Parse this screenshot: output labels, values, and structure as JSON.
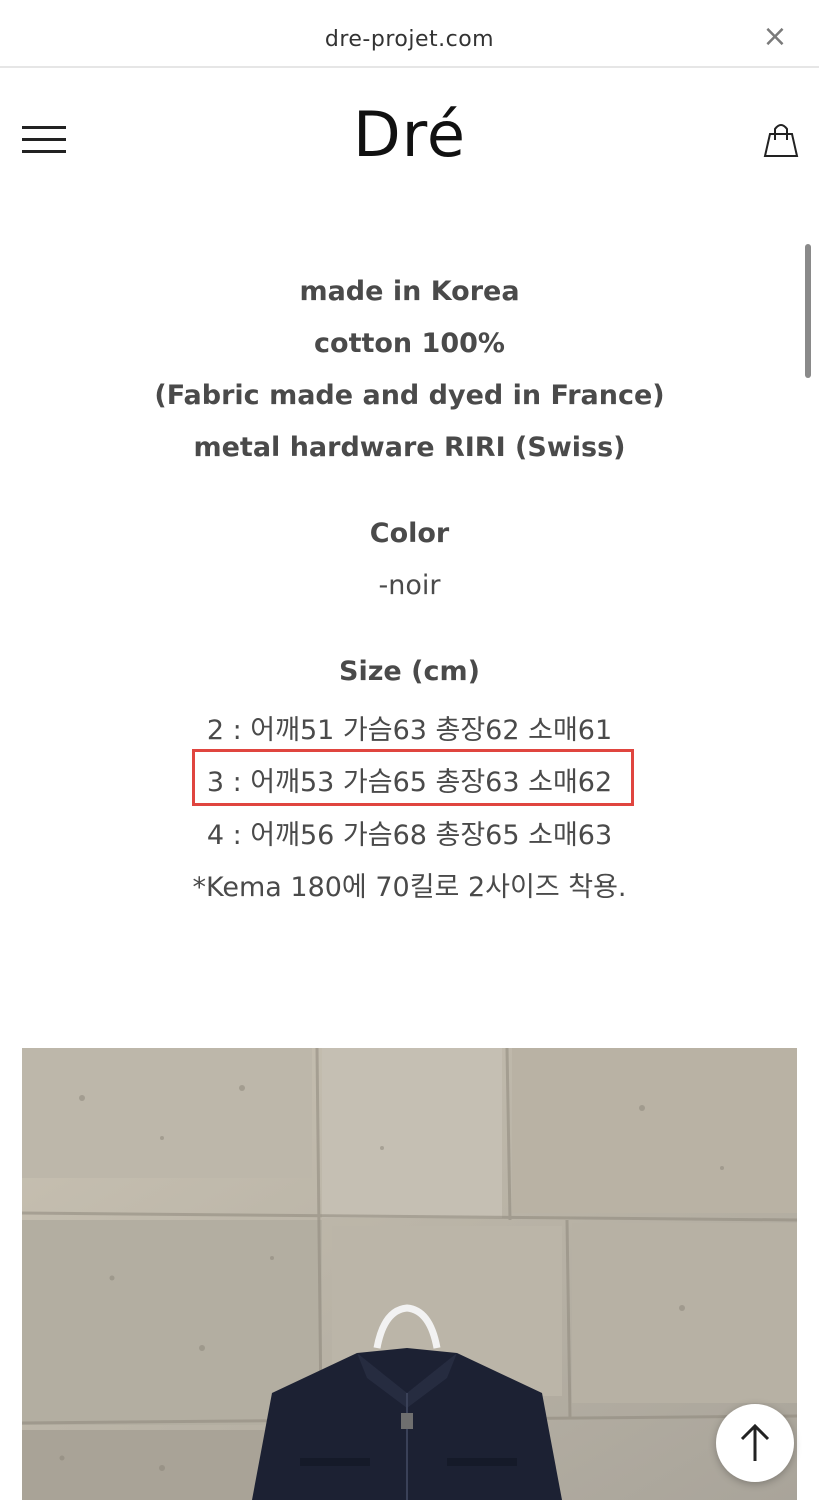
{
  "browser": {
    "url": "dre-projet.com",
    "close_symbol": "×"
  },
  "header": {
    "logo": "Dré",
    "menu_icon": "hamburger-menu-icon",
    "cart_icon": "shopping-bag-icon"
  },
  "product_info": {
    "material_lines": [
      "made in Korea",
      "cotton 100%",
      "(Fabric made and dyed in France)",
      "metal hardware RIRI (Swiss)"
    ],
    "color_heading": "Color",
    "color_value": "-noir",
    "size_heading": "Size (cm)",
    "sizes": [
      "2 : 어깨51 가슴63 총장62 소매61",
      "3 : 어깨53 가슴65 총장63 소매62",
      "4 : 어깨56 가슴68 총장65 소매63"
    ],
    "note": "*Kema 180에 70킬로 2사이즈 착용.",
    "highlighted_size_index": 1
  },
  "colors": {
    "highlight_border": "#e0453f",
    "text": "#4a4a4a",
    "jacket": "#1c2133"
  },
  "scroll_top_icon": "arrow-up-icon"
}
